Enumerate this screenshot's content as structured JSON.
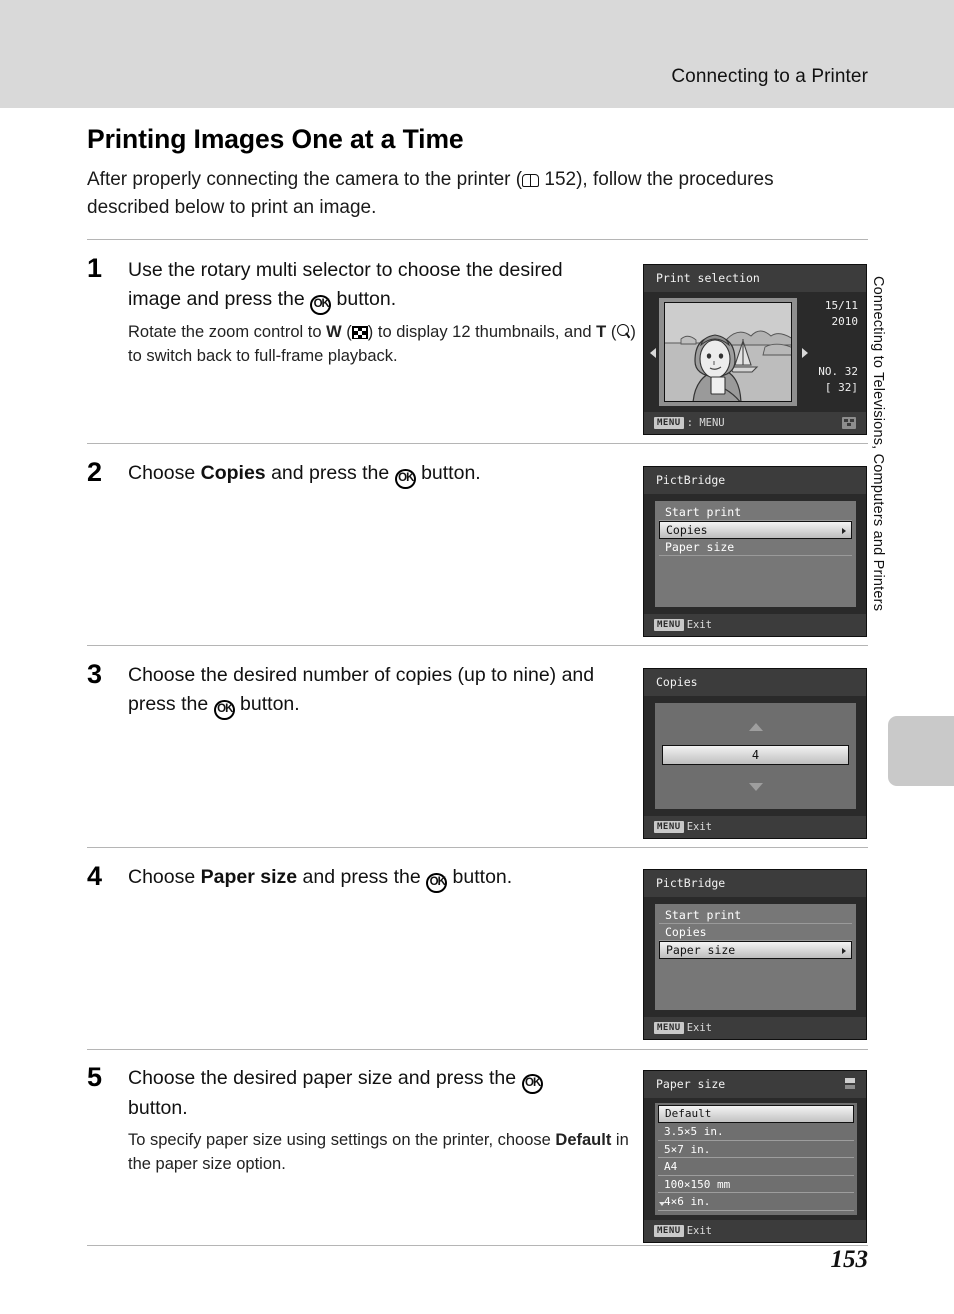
{
  "header": {
    "running_head": "Connecting to a Printer"
  },
  "side_tab": {
    "label": "Connecting to Televisions, Computers and Printers"
  },
  "page": {
    "title": "Printing Images One at a Time",
    "intro_before": "After properly connecting the camera to the printer (",
    "intro_ref": "152",
    "intro_after": "), follow the procedures described below to print an image.",
    "number": "153"
  },
  "steps": [
    {
      "number": "1",
      "head_part1": "Use the rotary multi selector to choose the desired image and press the ",
      "head_ok": "OK",
      "head_part2": " button.",
      "body_1": "Rotate the zoom control to ",
      "body_w": "W",
      "body_2": " (",
      "body_3": ") to display 12 thumbnails, and ",
      "body_t": "T",
      "body_4": " (",
      "body_5": ") to switch back to full-frame playback."
    },
    {
      "number": "2",
      "head_part1": "Choose ",
      "head_bold": "Copies",
      "head_part2": " and press the ",
      "head_ok": "OK",
      "head_part3": " button."
    },
    {
      "number": "3",
      "head_part1": "Choose the desired number of copies (up to nine) and press the ",
      "head_ok": "OK",
      "head_part2": " button."
    },
    {
      "number": "4",
      "head_part1": "Choose ",
      "head_bold": "Paper size",
      "head_part2": " and press the ",
      "head_ok": "OK",
      "head_part3": " button."
    },
    {
      "number": "5",
      "head_part1": "Choose the desired paper size and press the ",
      "head_ok": "OK",
      "head_part2": " button.",
      "body_1": "To specify paper size using settings on the printer, choose ",
      "body_bold": "Default",
      "body_2": " in the paper size option."
    }
  ],
  "screens": {
    "print_selection": {
      "title": "Print selection",
      "date_line1": "15/11",
      "date_line2": "2010",
      "number_label": "NO. 32",
      "number_bracket": "[   32]",
      "footer_badge": "MENU",
      "footer_label": ": MENU"
    },
    "pictbridge_copies": {
      "title": "PictBridge",
      "items": [
        {
          "label": "Start print",
          "selected": false
        },
        {
          "label": "Copies",
          "selected": true
        },
        {
          "label": "Paper size",
          "selected": false
        }
      ],
      "footer_badge": "MENU",
      "footer_label": "Exit"
    },
    "copies": {
      "title": "Copies",
      "value": "4",
      "footer_badge": "MENU",
      "footer_label": "Exit"
    },
    "pictbridge_paper": {
      "title": "PictBridge",
      "items": [
        {
          "label": "Start print",
          "selected": false
        },
        {
          "label": "Copies",
          "selected": false
        },
        {
          "label": "Paper size",
          "selected": true
        }
      ],
      "footer_badge": "MENU",
      "footer_label": "Exit"
    },
    "paper_size": {
      "title": "Paper size",
      "items": [
        {
          "label": "Default",
          "selected": true
        },
        {
          "label": "3.5×5 in.",
          "selected": false
        },
        {
          "label": "5×7 in.",
          "selected": false
        },
        {
          "label": "A4",
          "selected": false
        },
        {
          "label": "100×150 mm",
          "selected": false
        },
        {
          "label": "4×6 in.",
          "selected": false
        }
      ],
      "footer_badge": "MENU",
      "footer_label": "Exit"
    }
  },
  "colors": {
    "header_band": "#d9d9d9",
    "screen_bg": "#2a2a2a",
    "screen_title_bar": "#3c3c3c",
    "menu_panel": "#777777",
    "tab_marker": "#c9c9c9"
  }
}
